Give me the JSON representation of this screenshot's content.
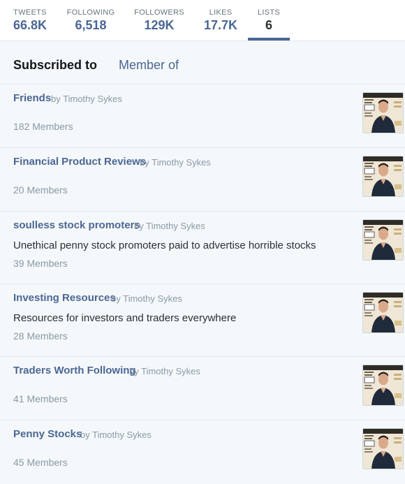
{
  "stats": [
    {
      "label": "TWEETS",
      "value": "66.8K"
    },
    {
      "label": "FOLLOWING",
      "value": "6,518"
    },
    {
      "label": "FOLLOWERS",
      "value": "129K"
    },
    {
      "label": "LIKES",
      "value": "17.7K"
    },
    {
      "label": "LISTS",
      "value": "6"
    }
  ],
  "tabs": {
    "subscribed": "Subscribed to",
    "member": "Member of"
  },
  "lists": [
    {
      "name": "Friends",
      "by": "by",
      "owner": "Timothy Sykes",
      "description": "",
      "members": "182 Members"
    },
    {
      "name": "Financial Product Reviews",
      "by": "by",
      "owner": "Timothy Sykes",
      "description": "",
      "members": "20 Members"
    },
    {
      "name": "soulless stock promoters",
      "by": "by",
      "owner": "Timothy Sykes",
      "description": "Unethical penny stock promoters paid to advertise horrible stocks",
      "members": "39 Members"
    },
    {
      "name": "Investing Resources",
      "by": "by",
      "owner": "Timothy Sykes",
      "description": "Resources for investors and traders everywhere",
      "members": "28 Members"
    },
    {
      "name": "Traders Worth Following",
      "by": "by",
      "owner": "Timothy Sykes",
      "description": "",
      "members": "41 Members"
    },
    {
      "name": "Penny Stocks",
      "by": "by",
      "owner": "Timothy Sykes",
      "description": "",
      "members": "45 Members"
    }
  ]
}
